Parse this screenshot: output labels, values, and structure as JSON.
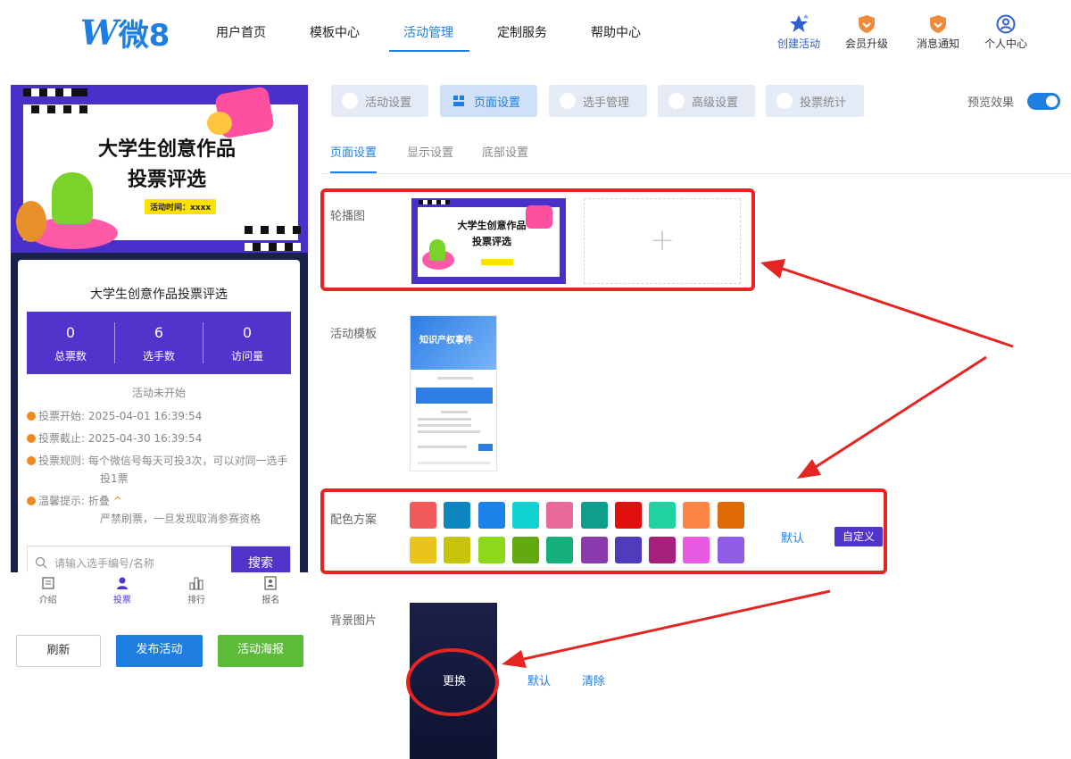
{
  "brand": {
    "logo_mark": "W",
    "logo_text": "微8"
  },
  "nav": {
    "items": [
      {
        "label": "用户首页"
      },
      {
        "label": "模板中心"
      },
      {
        "label": "活动管理"
      },
      {
        "label": "定制服务"
      },
      {
        "label": "帮助中心"
      }
    ],
    "active_index": 2
  },
  "tools": [
    {
      "label": "创建活动",
      "icon": "star-icon"
    },
    {
      "label": "会员升级",
      "icon": "shield-icon"
    },
    {
      "label": "消息通知",
      "icon": "bell-icon"
    },
    {
      "label": "个人中心",
      "icon": "user-icon"
    }
  ],
  "preview": {
    "banner_title_line1": "大学生创意作品",
    "banner_title_line2": "投票评选",
    "banner_time": "活动时间：xxxx",
    "event_title": "大学生创意作品投票评选",
    "stats": [
      {
        "value": "0",
        "label": "总票数"
      },
      {
        "value": "6",
        "label": "选手数"
      },
      {
        "value": "0",
        "label": "访问量"
      }
    ],
    "status": "活动未开始",
    "rules": {
      "vote_start_label": "投票开始:",
      "vote_start": "2025-04-01 16:39:54",
      "vote_end_label": "投票截止:",
      "vote_end": "2025-04-30 16:39:54",
      "vote_rule_label": "投票规则:",
      "vote_rule_line1": "每个微信号每天可投3次，可以对同一选手",
      "vote_rule_line2": "投1票",
      "tip_label": "温馨提示:",
      "tip_fold": "折叠",
      "tip_text": "严禁刷票，一旦发现取消参赛资格"
    },
    "search_placeholder": "请输入选手编号/名称",
    "search_button": "搜索",
    "tabbar": [
      {
        "label": "介绍",
        "icon": "intro-icon"
      },
      {
        "label": "投票",
        "icon": "vote-icon"
      },
      {
        "label": "排行",
        "icon": "ranking-icon"
      },
      {
        "label": "报名",
        "icon": "signup-icon"
      }
    ],
    "tabbar_active_index": 1
  },
  "actions": {
    "refresh": "刷新",
    "publish": "发布活动",
    "poster": "活动海报"
  },
  "settings": {
    "tabs": [
      {
        "label": "活动设置"
      },
      {
        "label": "页面设置"
      },
      {
        "label": "选手管理"
      },
      {
        "label": "高级设置"
      },
      {
        "label": "投票统计"
      }
    ],
    "active_tab_index": 1,
    "preview_label": "预览效果",
    "preview_on": true,
    "subtabs": [
      {
        "label": "页面设置"
      },
      {
        "label": "显示设置"
      },
      {
        "label": "底部设置"
      }
    ],
    "active_subtab_index": 0,
    "carousel_label": "轮播图",
    "carousel_thumb_line1": "大学生创意作品",
    "carousel_thumb_line2": "投票评选",
    "upload_plus": "+",
    "template_label": "活动模板",
    "template_thumb_title": "知识产权事件",
    "color_label": "配色方案",
    "colors": [
      "#f25b5b",
      "#0b86bf",
      "#1c84e8",
      "#0fd2d2",
      "#e86a9a",
      "#0e9e8c",
      "#e20f0f",
      "#1fd3a3",
      "#fb8643",
      "#e06a06",
      "#e8c41c",
      "#c8c40c",
      "#8ed81c",
      "#62aa10",
      "#16b07a",
      "#8b3aad",
      "#4e3cbc",
      "#a5207a",
      "#e85ae2",
      "#8e5ce6"
    ],
    "color_default": "默认",
    "color_custom": "自定义",
    "bg_label": "背景图片",
    "bg_change": "更换",
    "bg_default": "默认",
    "bg_clear": "清除"
  },
  "annotation_color": "#e52521"
}
